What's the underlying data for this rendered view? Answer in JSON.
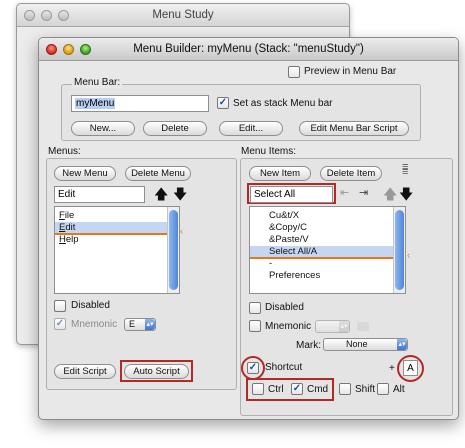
{
  "bg_window": {
    "title": "Menu Study"
  },
  "window": {
    "title": "Menu Builder: myMenu (Stack: \"menuStudy\")"
  },
  "top": {
    "preview_label": "Preview in Menu Bar",
    "menubar_label": "Menu Bar:",
    "menubar_name": "myMenu",
    "stack_menubar_label": "Set as stack Menu bar",
    "new_btn": "New...",
    "delete_btn": "Delete",
    "edit_btn": "Edit...",
    "edit_script_btn": "Edit Menu Bar Script"
  },
  "menus": {
    "label": "Menus:",
    "new_btn": "New Menu",
    "delete_btn": "Delete Menu",
    "name_value": "Edit",
    "items": [
      {
        "text": "File",
        "underline": "F",
        "rest": "ile"
      },
      {
        "text": "Edit",
        "underline": "E",
        "rest": "dit"
      },
      {
        "text": "Help",
        "underline": "H",
        "rest": "elp"
      }
    ],
    "disabled_label": "Disabled",
    "mnemonic_label": "Mnemonic",
    "mnemonic_value": "E",
    "edit_script_btn": "Edit Script",
    "auto_script_btn": "Auto Script"
  },
  "items": {
    "label": "Menu Items:",
    "new_btn": "New Item",
    "delete_btn": "Delete Item",
    "name_value": "Select All",
    "list": [
      "Cu&t/X",
      "&Copy/C",
      "&Paste/V",
      "Select All/A",
      "-",
      "Preferences"
    ],
    "disabled_label": "Disabled",
    "mnemonic_label": "Mnemonic",
    "mark_label": "Mark:",
    "mark_value": "None",
    "shortcut_label": "Shortcut",
    "plus": "+",
    "shortcut_key": "A",
    "ctrl_label": "Ctrl",
    "cmd_label": "Cmd",
    "shift_label": "Shift",
    "alt_label": "Alt"
  },
  "colors": {
    "highlight": "#b22a25",
    "selection": "#c4d6f2",
    "accent": "#3d74cf"
  }
}
